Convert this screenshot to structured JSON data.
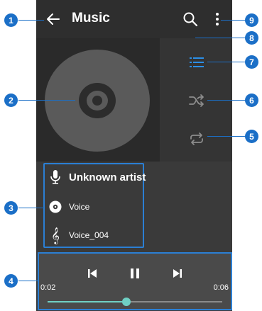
{
  "app_bar": {
    "title": "Music",
    "back_icon": "arrow-left-icon",
    "search_icon": "search-icon",
    "more_icon": "more-vertical-icon"
  },
  "album_art": {
    "icon": "disc-icon"
  },
  "side_actions": [
    {
      "name": "playlist",
      "icon": "list-icon",
      "active": true
    },
    {
      "name": "shuffle",
      "icon": "shuffle-icon",
      "active": false
    },
    {
      "name": "repeat",
      "icon": "repeat-icon",
      "active": false
    }
  ],
  "track_info": {
    "artist": "Unknown artist",
    "album": "Voice",
    "title": "Voice_004"
  },
  "player": {
    "elapsed": "0:02",
    "duration": "0:06",
    "progress": 0.45
  },
  "callouts": {
    "c1": "1",
    "c2": "2",
    "c3": "3",
    "c4": "4",
    "c5": "5",
    "c6": "6",
    "c7": "7",
    "c8": "8",
    "c9": "9"
  },
  "colors": {
    "accent": "#6fd0c4",
    "callout": "#1b6fc7",
    "highlight": "#2b7fd4",
    "active_icon": "#2b8fe8"
  }
}
